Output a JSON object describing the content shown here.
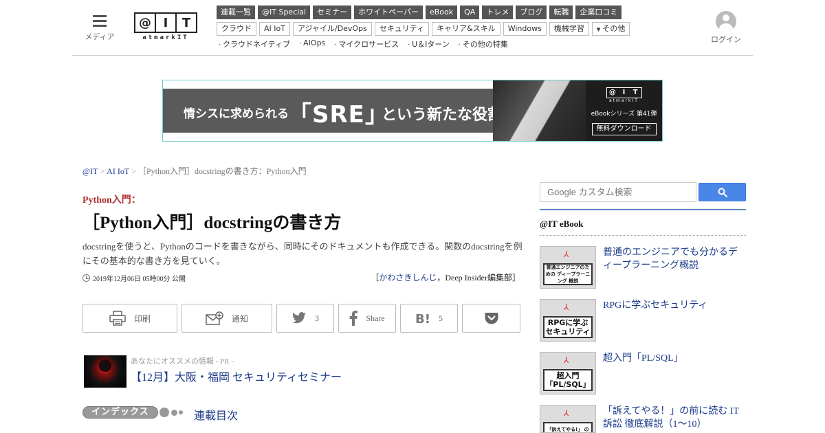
{
  "header": {
    "menu_label": "メディア",
    "logo": {
      "mark": [
        "@",
        "I",
        "T"
      ],
      "sub": "atmarkIT"
    },
    "nav_primary": [
      "連載一覧",
      "@IT Special",
      "セミナー",
      "ホワイトペーパー",
      "eBook",
      "QA",
      "トレメ",
      "ブログ",
      "転職",
      "企業口コミ"
    ],
    "nav_secondary": [
      "クラウド",
      "AI IoT",
      "アジャイル/DevOps",
      "セキュリティ",
      "キャリア&スキル",
      "Windows",
      "機械学習"
    ],
    "nav_more": "その他",
    "nav_tertiary": [
      "クラウドネイティブ",
      "AIOps",
      "マイクロサービス",
      "U＆Iターン",
      "その他の特集"
    ],
    "login_label": "ログイン"
  },
  "banner": {
    "text_left": "情シスに求められる",
    "text_big": "「SRE」",
    "text_right": "という新たな役割",
    "logo_mark": [
      "@",
      "I",
      "T"
    ],
    "logo_sub": "atmarkIT",
    "series": "eBookシリーズ 第41弾",
    "download": "無料ダウンロード"
  },
  "breadcrumb": {
    "home": "@IT",
    "section": "AI IoT",
    "current": "［Python入門］docstringの書き方：Python入門"
  },
  "article": {
    "series_label": "Python入門：",
    "title": "［Python入門］docstringの書き方",
    "lead": "docstringを使うと、Pythonのコードを書きながら、同時にそのドキュメントも作成できる。関数のdocstringを例にその基本的な書き方を見ていく。",
    "date": "2019年12月06日 05時00分 公開",
    "author_open": "［",
    "author_name": "かわさきしんじ",
    "author_rest": "，Deep Insider編集部］"
  },
  "share": {
    "print": "印刷",
    "notify": "通知",
    "twitter_count": "3",
    "facebook": "Share",
    "hatena_count": "5"
  },
  "pr": {
    "tag": "あなたにオススメの情報 - PR -",
    "headline": "【12月】大阪・福岡 セキュリティセミナー"
  },
  "index": {
    "pill": "インデックス",
    "link": "連載目次"
  },
  "sidebar": {
    "search_placeholder": "Google カスタム検索",
    "ebook_heading": "@IT eBook",
    "ebooks": [
      {
        "cover": "普通エンジニアのための ディープラーニング 概説",
        "title": "普通のエンジニアでも分かるディープラーニング概説"
      },
      {
        "cover": "RPGに学ぶ セキュリティ",
        "title": "RPGに学ぶセキュリティ"
      },
      {
        "cover": "超入門 「PL/SQL」",
        "title": "超入門「PL/SQL」"
      },
      {
        "cover": "「訴えてやる!」 の前に読む",
        "title": "「訴えてやる！」の前に読む IT訴訟 徹底解説（1～10）"
      }
    ]
  },
  "colors": {
    "link": "#1a3a8a",
    "series": "#b03030",
    "nav_dark": "#555555",
    "search_button": "#4a86e8"
  },
  "icons": [
    "menu-icon",
    "user-avatar-icon",
    "print-icon",
    "mail-plus-icon",
    "twitter-icon",
    "facebook-icon",
    "hatena-bookmark-icon",
    "pocket-icon",
    "search-icon",
    "pdf-icon",
    "clock-icon"
  ]
}
